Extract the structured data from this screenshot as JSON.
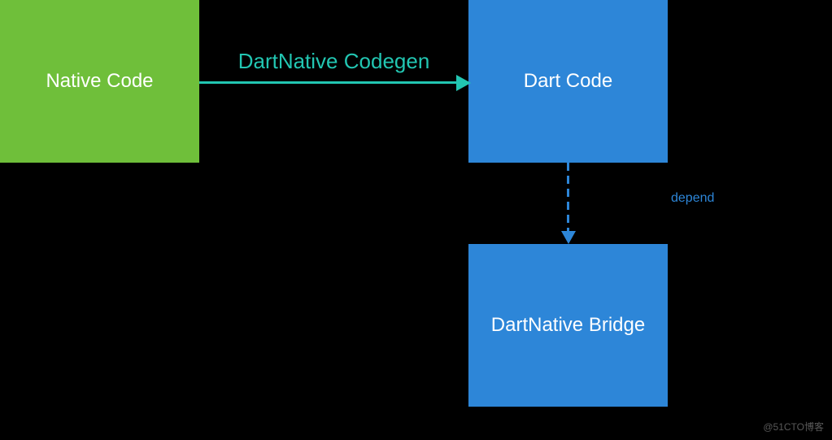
{
  "nodes": {
    "native_code": {
      "label": "Native Code"
    },
    "dart_code": {
      "label": "Dart Code"
    },
    "dart_native_bridge": {
      "label": "DartNative Bridge"
    }
  },
  "edges": {
    "codegen": {
      "label": "DartNative Codegen"
    },
    "depend": {
      "label": "depend"
    }
  },
  "watermark": "@51CTO博客",
  "chart_data": {
    "type": "flow-diagram",
    "nodes": [
      {
        "id": "native_code",
        "label": "Native Code",
        "color": "#6fbf3a"
      },
      {
        "id": "dart_code",
        "label": "Dart Code",
        "color": "#2d86d8"
      },
      {
        "id": "dart_native_bridge",
        "label": "DartNative Bridge",
        "color": "#2d86d8"
      }
    ],
    "edges": [
      {
        "from": "native_code",
        "to": "dart_code",
        "label": "DartNative Codegen",
        "style": "solid",
        "color": "#22c6b2"
      },
      {
        "from": "dart_code",
        "to": "dart_native_bridge",
        "label": "depend",
        "style": "dashed",
        "color": "#2d86d8"
      }
    ]
  }
}
